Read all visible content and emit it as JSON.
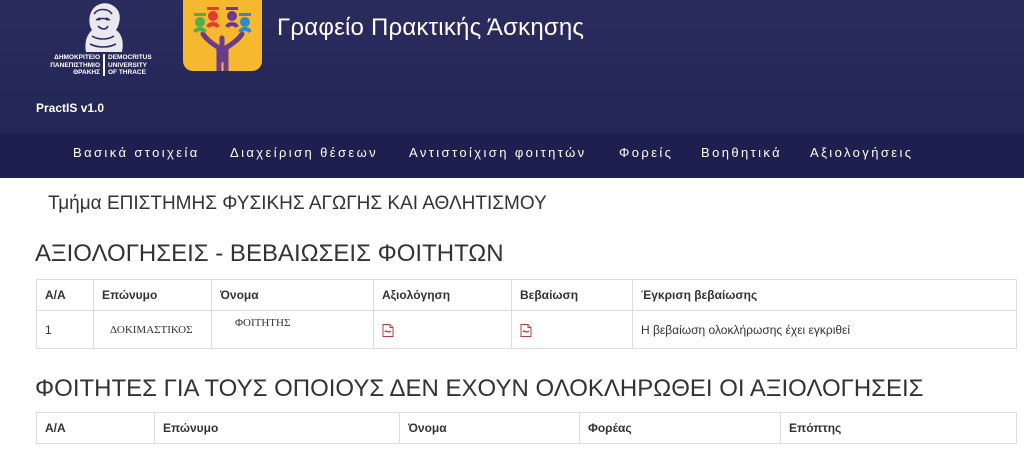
{
  "header": {
    "university_gr": "ΔΗΜΟΚΡΙΤΕΙΟ\nΠΑΝΕΠΙΣΤΗΜΙΟ\nΘΡΑΚΗΣ",
    "university_en": "DEMOCRITUS\nUNIVERSITY\nOF THRACE",
    "app_title": "Γραφείο Πρακτικής Άσκησης",
    "version": "PractIS v1.0",
    "app_logo_color": "#f5b82e",
    "background": "#26285a"
  },
  "nav": {
    "items": [
      "Βασικά στοιχεία",
      "Διαχείριση θέσεων",
      "Αντιστοίχιση φοιτητών",
      "Φορείς",
      "Βοηθητικά",
      "Αξιολογήσεις"
    ],
    "background": "#1d1f4e"
  },
  "department": "Τμήμα ΕΠΙΣΤΗΜΗΣ ΦΥΣΙΚΗΣ ΑΓΩΓΗΣ ΚΑΙ ΑΘΛΗΤΙΣΜΟΥ",
  "certificates": {
    "title": "ΑΞΙΟΛΟΓΗΣΕΙΣ - ΒΕΒΑΙΩΣΕΙΣ ΦΟΙΤΗΤΩΝ",
    "headers": [
      "Α/Α",
      "Επώνυμο",
      "Όνομα",
      "Αξιολόγηση",
      "Βεβαίωση",
      "Έγκριση βεβαίωσης"
    ],
    "rows": [
      {
        "aa": "1",
        "surname": "ΔΟΚΙΜΑΣΤΙΚΟΣ",
        "name": "ΦΟΙΤΗΤΗΣ",
        "evaluation_icon": "pdf-icon",
        "certificate_icon": "pdf-icon",
        "approval": "Η βεβαίωση ολοκλήρωσης έχει εγκριθεί"
      }
    ]
  },
  "pending": {
    "title": "ΦΟΙΤΗΤΕΣ ΓΙΑ ΤΟΥΣ ΟΠΟΙΟΥΣ ΔΕΝ ΕΧΟΥΝ ΟΛΟΚΛΗΡΩΘΕΙ ΟΙ ΑΞΙΟΛΟΓΗΣΕΙΣ",
    "headers": [
      "Α/Α",
      "Επώνυμο",
      "Όνομα",
      "Φορέας",
      "Επόπτης"
    ]
  }
}
